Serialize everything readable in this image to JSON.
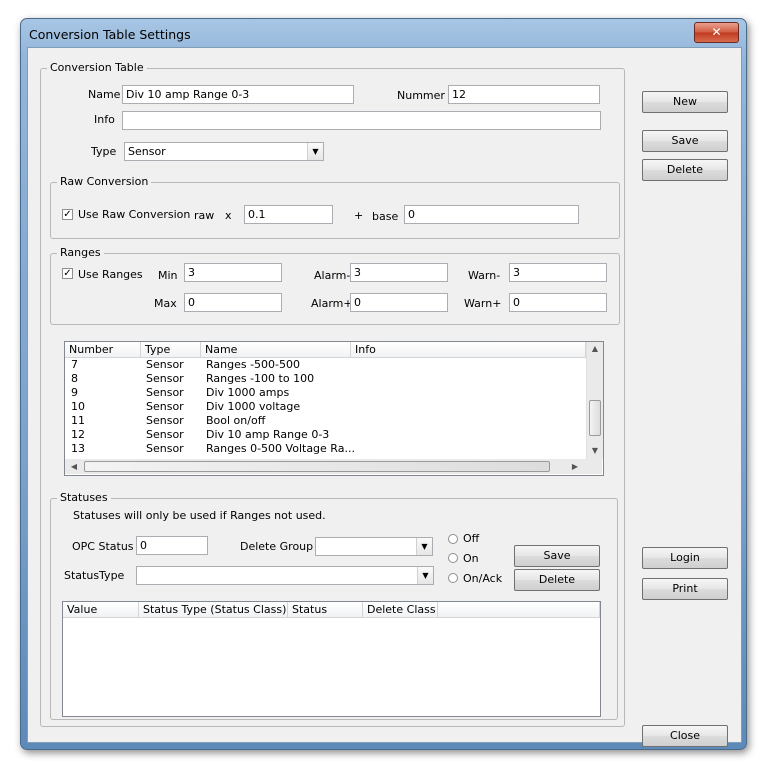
{
  "window": {
    "title": "Conversion Table Settings",
    "close_glyph": "✕"
  },
  "conversion_table": {
    "group_label": "Conversion Table",
    "name_label": "Name",
    "name_value": "Div 10 amp Range 0-3",
    "nummer_label": "Nummer",
    "nummer_value": "12",
    "info_label": "Info",
    "info_value": "",
    "type_label": "Type",
    "type_value": "Sensor"
  },
  "raw_conversion": {
    "group_label": "Raw Conversion",
    "use_label": "Use Raw Conversion",
    "checked": true,
    "raw_label": "raw",
    "x_label": "x",
    "raw_value": "0.1",
    "plus_label": "+",
    "base_label": "base",
    "base_value": "0"
  },
  "ranges": {
    "group_label": "Ranges",
    "use_label": "Use Ranges",
    "checked": true,
    "min_label": "Min",
    "min_value": "3",
    "max_label": "Max",
    "max_value": "0",
    "alarm_minus_label": "Alarm-",
    "alarm_minus_value": "3",
    "alarm_plus_label": "Alarm+",
    "alarm_plus_value": "0",
    "warn_minus_label": "Warn-",
    "warn_minus_value": "3",
    "warn_plus_label": "Warn+",
    "warn_plus_value": "0"
  },
  "table_list": {
    "columns": [
      "Number",
      "Type",
      "Name",
      "Info"
    ],
    "rows": [
      {
        "number": "7",
        "type": "Sensor",
        "name": "Ranges -500-500",
        "info": ""
      },
      {
        "number": "8",
        "type": "Sensor",
        "name": "Ranges -100 to 100",
        "info": ""
      },
      {
        "number": "9",
        "type": "Sensor",
        "name": "Div 1000 amps",
        "info": ""
      },
      {
        "number": "10",
        "type": "Sensor",
        "name": "Div 1000 voltage",
        "info": ""
      },
      {
        "number": "11",
        "type": "Sensor",
        "name": "Bool on/off",
        "info": ""
      },
      {
        "number": "12",
        "type": "Sensor",
        "name": "Div 10 amp Range 0-3",
        "info": ""
      },
      {
        "number": "13",
        "type": "Sensor",
        "name": "Ranges 0-500 Voltage Ra...",
        "info": ""
      }
    ]
  },
  "statuses": {
    "group_label": "Statuses",
    "note": "Statuses will only be used if Ranges not used.",
    "opc_label": "OPC Status",
    "opc_value": "0",
    "delete_group_label": "Delete Group",
    "delete_group_value": "",
    "status_type_label": "StatusType",
    "status_type_value": "",
    "radio_off": "Off",
    "radio_on": "On",
    "radio_onack": "On/Ack",
    "save_label": "Save",
    "delete_label": "Delete",
    "columns": [
      "Value",
      "Status Type (Status Class)",
      "Status",
      "Delete Class"
    ]
  },
  "side_buttons": {
    "new": "New",
    "save": "Save",
    "delete": "Delete",
    "login": "Login",
    "print": "Print",
    "close": "Close"
  }
}
